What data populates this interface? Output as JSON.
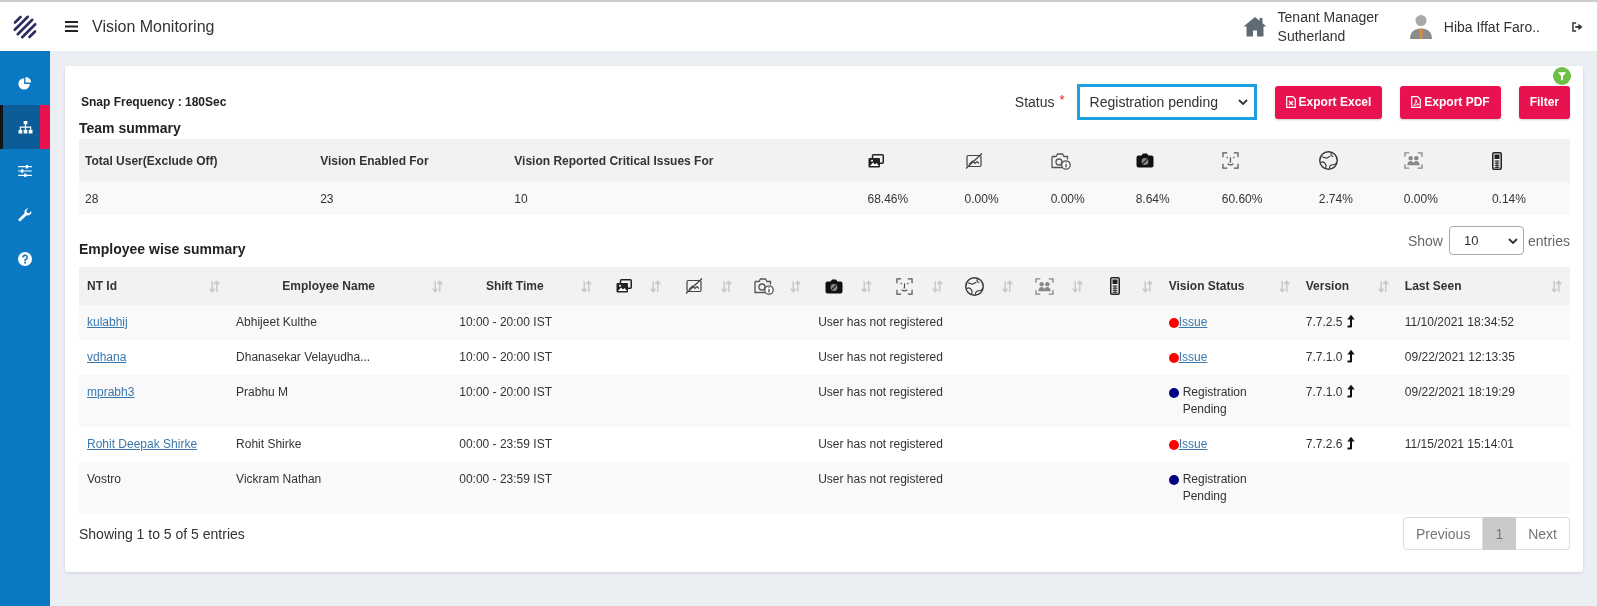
{
  "header": {
    "title": "Vision Monitoring",
    "tenant": {
      "role": "Tenant Manager",
      "name": "Sutherland"
    },
    "user": {
      "name": "Hiba Iffat Faro.."
    }
  },
  "sidebar": {
    "items": [
      {
        "selected": false
      },
      {
        "selected": true
      },
      {
        "selected": false
      },
      {
        "selected": false
      },
      {
        "selected": false
      }
    ]
  },
  "toolbar": {
    "snap_frequency": "Snap Frequency : 180Sec",
    "status_filter": {
      "label": "Status",
      "required_mark": "*",
      "value": "Registration pending"
    },
    "buttons": [
      {
        "kind": "excel",
        "label": "Export Excel"
      },
      {
        "kind": "pdf",
        "label": "Export PDF"
      },
      {
        "kind": "filter",
        "label": "Filter"
      }
    ]
  },
  "team_summary": {
    "title": "Team summary",
    "columns": [
      {
        "kind": "text",
        "label": "Total User(Exclude Off)"
      },
      {
        "kind": "text",
        "label": "Vision Enabled For"
      },
      {
        "kind": "text",
        "label": "Vision Reported Critical Issues For"
      },
      {
        "kind": "icon"
      },
      {
        "kind": "icon"
      },
      {
        "kind": "icon"
      },
      {
        "kind": "icon"
      },
      {
        "kind": "icon"
      },
      {
        "kind": "icon"
      },
      {
        "kind": "icon"
      },
      {
        "kind": "icon"
      }
    ],
    "values": [
      "28",
      "23",
      "10",
      "68.46%",
      "0.00%",
      "0.00%",
      "8.64%",
      "60.60%",
      "2.74%",
      "0.00%",
      "0.14%"
    ]
  },
  "employee_summary": {
    "title": "Employee wise summary",
    "page_length": {
      "label": "Show",
      "value": "10",
      "suffix": "entries"
    },
    "columns": [
      {
        "kind": "text",
        "label": "NT Id"
      },
      {
        "kind": "text",
        "label": "Employee Name"
      },
      {
        "kind": "text",
        "label": "Shift Time"
      },
      {
        "kind": "icon"
      },
      {
        "kind": "icon"
      },
      {
        "kind": "icon"
      },
      {
        "kind": "icon"
      },
      {
        "kind": "icon"
      },
      {
        "kind": "icon"
      },
      {
        "kind": "icon"
      },
      {
        "kind": "icon"
      },
      {
        "kind": "text",
        "label": "Vision Status"
      },
      {
        "kind": "text",
        "label": "Version"
      },
      {
        "kind": "text",
        "label": "Last Seen"
      }
    ],
    "rows": [
      {
        "nt_id": {
          "text": "kulabhij",
          "link": true
        },
        "name": "Abhijeet Kulthe",
        "shift": "10:00 - 20:00 IST",
        "vision_message": "User has not registered",
        "vision_status": {
          "label": "Issue",
          "link": true,
          "color": "#ff0000"
        },
        "version": "7.7.2.5",
        "last_seen": "11/10/2021 18:34:52"
      },
      {
        "nt_id": {
          "text": "vdhana",
          "link": true
        },
        "name": "Dhanasekar Velayudha...",
        "shift": "10:00 - 20:00 IST",
        "vision_message": "User has not registered",
        "vision_status": {
          "label": "Issue",
          "link": true,
          "color": "#ff0000"
        },
        "version": "7.7.1.0",
        "last_seen": "09/22/2021 12:13:35"
      },
      {
        "nt_id": {
          "text": "mprabh3",
          "link": true
        },
        "name": "Prabhu M",
        "shift": "10:00 - 20:00 IST",
        "vision_message": "User has not registered",
        "vision_status": {
          "label": "Registration Pending",
          "link": false,
          "color": "#000080"
        },
        "version": "7.7.1.0",
        "last_seen": "09/22/2021 18:19:29"
      },
      {
        "nt_id": {
          "text": "Rohit Deepak Shirke",
          "link": true
        },
        "name": "Rohit Shirke",
        "shift": "00:00 - 23:59 IST",
        "vision_message": "User has not registered",
        "vision_status": {
          "label": "Issue",
          "link": true,
          "color": "#ff0000"
        },
        "version": "7.7.2.6",
        "last_seen": "11/15/2021 15:14:01"
      },
      {
        "nt_id": {
          "text": "Vostro",
          "link": false
        },
        "name": "Vickram Nathan",
        "shift": "00:00 - 23:59 IST",
        "vision_message": "User has not registered",
        "vision_status": {
          "label": "Registration Pending",
          "link": false,
          "color": "#000080"
        }
      }
    ],
    "info": "Showing 1 to 5 of 5 entries",
    "pagination": {
      "previous": {
        "label": "Previous",
        "disabled": true
      },
      "pages": [
        {
          "label": "1",
          "selected": true
        }
      ],
      "next": {
        "label": "Next",
        "disabled": true
      }
    }
  }
}
